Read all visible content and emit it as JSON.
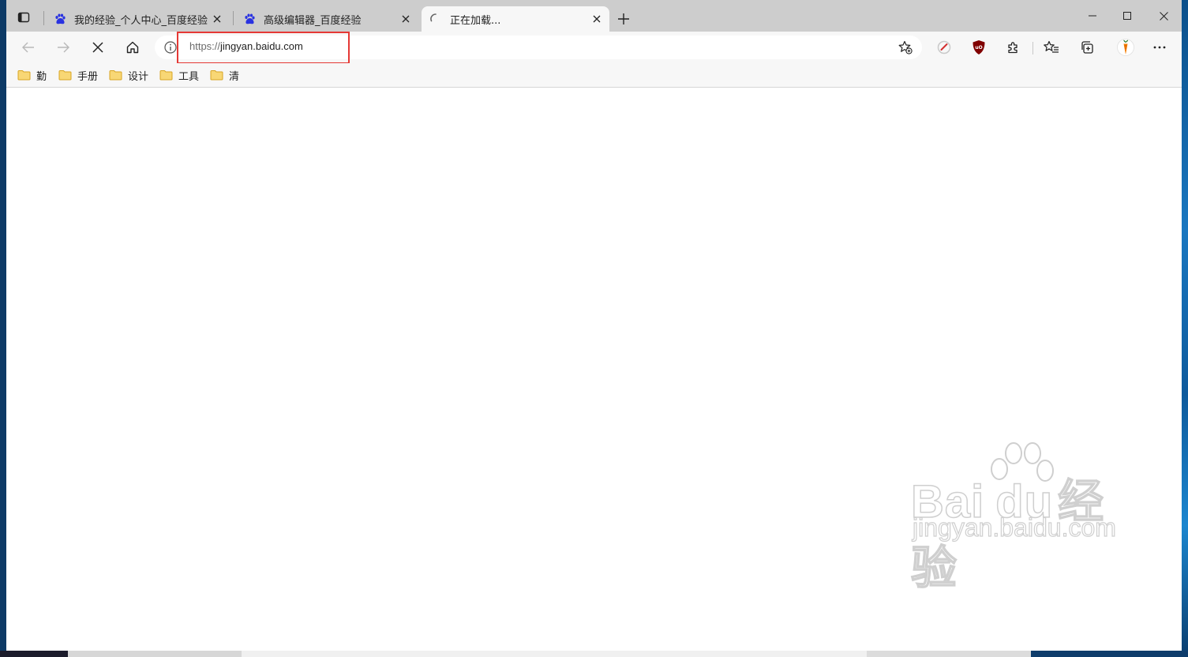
{
  "tabs": [
    {
      "title": "我的经验_个人中心_百度经验",
      "favicon": "baidu-paw-icon",
      "active": false
    },
    {
      "title": "高级编辑器_百度经验",
      "favicon": "baidu-paw-icon",
      "active": false
    },
    {
      "title": "正在加载...",
      "favicon": "loading-spinner-icon",
      "active": true
    }
  ],
  "address": {
    "scheme": "https://",
    "host": "jingyan.baidu.com"
  },
  "bookmarks": [
    {
      "label": "勤"
    },
    {
      "label": "手册"
    },
    {
      "label": "设计"
    },
    {
      "label": "工具"
    },
    {
      "label": "清"
    }
  ],
  "watermark": {
    "brand_text": "Bai",
    "brand_du": "du",
    "brand_cn": "经验",
    "url": "jingyan.baidu.com"
  },
  "colors": {
    "highlight": "#e53935",
    "tabstrip": "#cdcdcd",
    "toolbar": "#f7f7f7",
    "ublock": "#800000",
    "baidu_blue": "#2932e1"
  }
}
